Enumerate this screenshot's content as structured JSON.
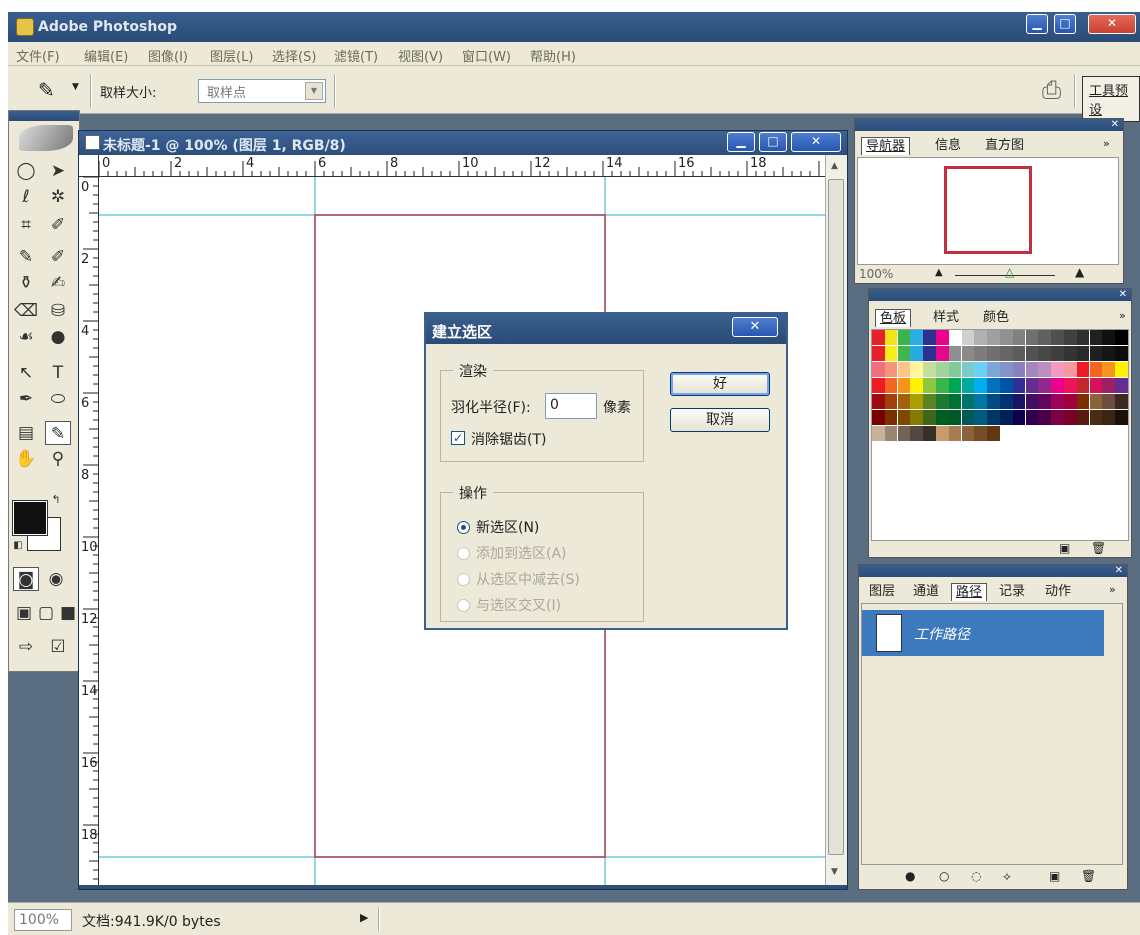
{
  "app": {
    "title": "Adobe Photoshop"
  },
  "menus": [
    "文件(F)",
    "编辑(E)",
    "图像(I)",
    "图层(L)",
    "选择(S)",
    "滤镜(T)",
    "视图(V)",
    "窗口(W)",
    "帮助(H)"
  ],
  "options_bar": {
    "sample_size_label": "取样大小:",
    "sample_size_value": "取样点",
    "workspace_button": "工具预设"
  },
  "document": {
    "title": "未标题-1 @ 100% (图层 1, RGB/8)",
    "ruler_h": [
      "0",
      "2",
      "4",
      "6",
      "8",
      "10",
      "12",
      "14",
      "16",
      "18"
    ],
    "ruler_v": [
      "0",
      "2",
      "4",
      "6",
      "8",
      "10",
      "12",
      "14",
      "16",
      "18"
    ]
  },
  "dialog": {
    "title": "建立选区",
    "render_group": "渲染",
    "feather_label": "羽化半径(F):",
    "feather_value": "0",
    "feather_unit": "像素",
    "antialias_label": "消除锯齿(T)",
    "antialias_checked": true,
    "operation_group": "操作",
    "operations": [
      {
        "label": "新选区(N)",
        "checked": true,
        "enabled": true
      },
      {
        "label": "添加到选区(A)",
        "checked": false,
        "enabled": false
      },
      {
        "label": "从选区中减去(S)",
        "checked": false,
        "enabled": false
      },
      {
        "label": "与选区交叉(I)",
        "checked": false,
        "enabled": false
      }
    ],
    "ok_label": "好",
    "cancel_label": "取消"
  },
  "navigator_panel": {
    "tabs": [
      "导航器",
      "信息",
      "直方图"
    ],
    "zoom": "100%"
  },
  "swatches_panel": {
    "tabs": [
      "色板",
      "样式",
      "颜色"
    ],
    "rows": [
      [
        "#e8202a",
        "#f2e21a",
        "#3ab54a",
        "#2aaee4",
        "#2e3192",
        "#ec008c",
        "#ffffff",
        "#d0d0d0",
        "#b0b0b0",
        "#a0a0a0",
        "#909090",
        "#808080",
        "#707070",
        "#606060",
        "#505050",
        "#404040",
        "#303030",
        "#202020",
        "#101010",
        "#000000"
      ],
      [
        "#e8202a",
        "#f7ec1c",
        "#3fb649",
        "#27aae1",
        "#2e3192",
        "#e4068b",
        "#8f8f8f",
        "#8a8a8a",
        "#7d7d7d",
        "#707070",
        "#666666",
        "#5c5c5c",
        "#525252",
        "#484848",
        "#3e3e3e",
        "#343434",
        "#2a2a2a",
        "#202020",
        "#161616",
        "#0c0c0c"
      ],
      [
        "#f26d7d",
        "#f69679",
        "#fdc689",
        "#fff799",
        "#c4df9b",
        "#a3d39c",
        "#82ca9c",
        "#7accc8",
        "#6dcff6",
        "#7da7d9",
        "#8393ca",
        "#8781bd",
        "#a187be",
        "#bc8dbf",
        "#f49ac2",
        "#f6989d",
        "#ed1c24",
        "#f26522",
        "#f7941d",
        "#fff200"
      ],
      [
        "#ed1c24",
        "#f26522",
        "#f7941d",
        "#fff200",
        "#8dc63f",
        "#39b54a",
        "#00a651",
        "#00a99d",
        "#00aeef",
        "#0072bc",
        "#0054a6",
        "#2e3192",
        "#662d91",
        "#92278f",
        "#ec008c",
        "#ed145b",
        "#c1272d",
        "#d4145a",
        "#9e1f63",
        "#662d91"
      ],
      [
        "#9e0b0f",
        "#a0410d",
        "#a36209",
        "#aba000",
        "#598527",
        "#1a7b30",
        "#007236",
        "#00746b",
        "#0076a3",
        "#004a80",
        "#003471",
        "#1b1464",
        "#440e62",
        "#630460",
        "#9e005d",
        "#9e0039",
        "#7b2e00",
        "#8c6239",
        "#6d4c41",
        "#3e2723"
      ],
      [
        "#790000",
        "#7b2e00",
        "#7d4900",
        "#827b00",
        "#406618",
        "#005e20",
        "#005826",
        "#005952",
        "#005b7f",
        "#003663",
        "#002157",
        "#0d004c",
        "#32004b",
        "#4b0049",
        "#7b0046",
        "#7a0026",
        "#5a1a0e",
        "#4a2c12",
        "#3a2510",
        "#1a1008"
      ],
      [
        "#c7b299",
        "#998675",
        "#736357",
        "#534741",
        "#37302a",
        "#c69c6d",
        "#a67c52",
        "#8c6239",
        "#754c24",
        "#603913"
      ]
    ]
  },
  "layers_panel": {
    "tabs": [
      "图层",
      "通道",
      "路径",
      "记录",
      "动作"
    ],
    "path_name": "工作路径"
  },
  "status": {
    "zoom": "100%",
    "doc_info": "文档:941.9K/0 bytes"
  }
}
